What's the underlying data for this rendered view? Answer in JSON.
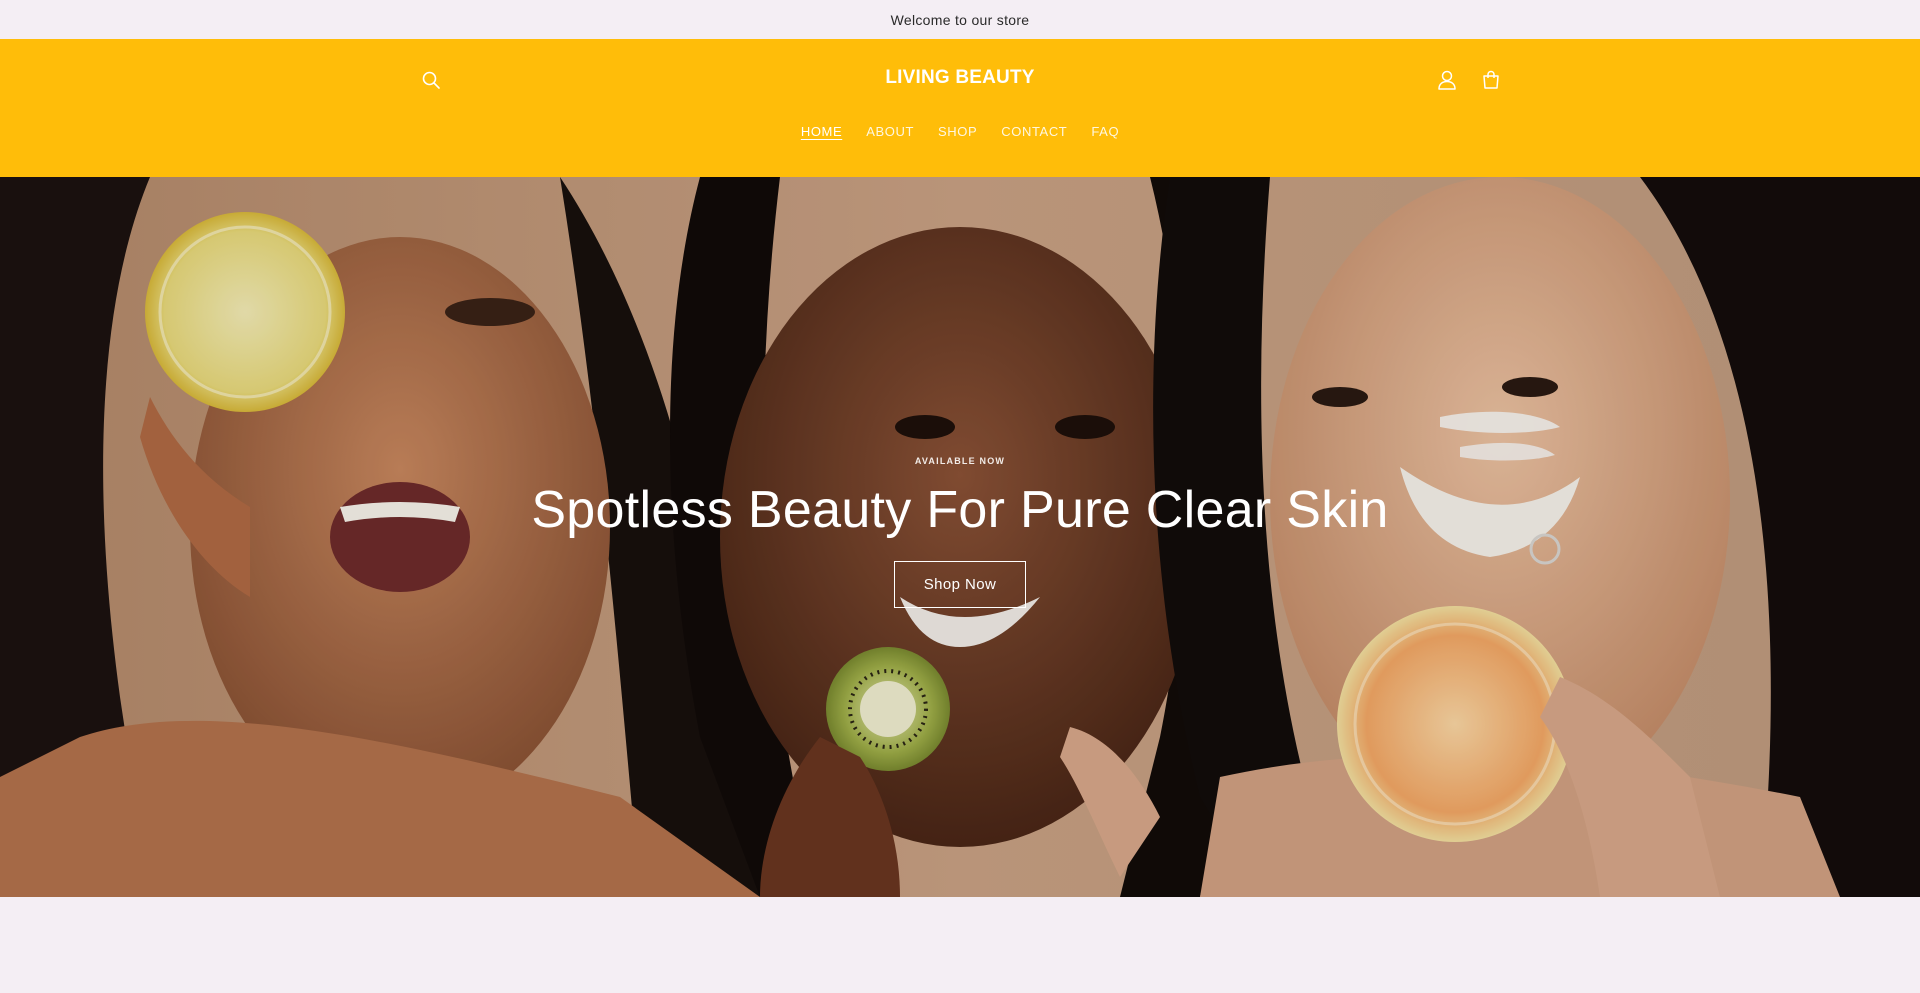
{
  "announcement": {
    "text": "Welcome to our store"
  },
  "header": {
    "logo": "LIVING BEAUTY",
    "search_icon": "search-icon",
    "account_icon": "account-icon",
    "cart_icon": "cart-icon",
    "bg_color": "#ffbd09"
  },
  "nav": {
    "items": [
      {
        "label": "HOME",
        "active": true
      },
      {
        "label": "ABOUT"
      },
      {
        "label": "SHOP"
      },
      {
        "label": "CONTACT"
      },
      {
        "label": "FAQ"
      }
    ]
  },
  "hero": {
    "eyebrow": "AVAILABLE NOW",
    "title": "Spotless Beauty For Pure Clear Skin",
    "button_label": "Shop Now"
  }
}
